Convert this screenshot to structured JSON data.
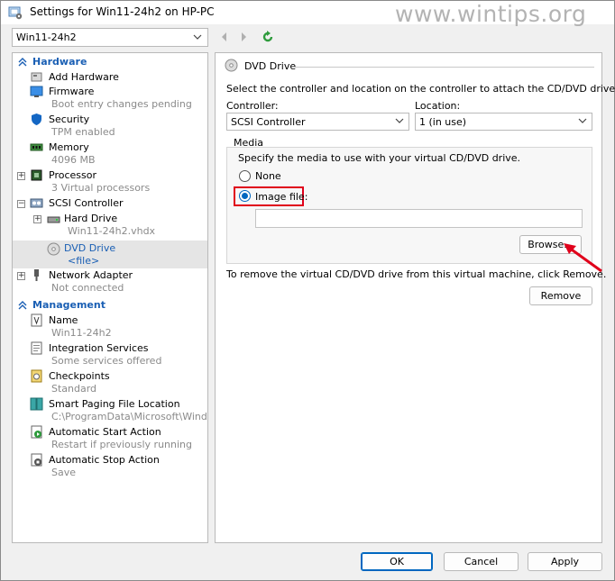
{
  "window": {
    "title": "Settings for Win11-24h2 on HP-PC",
    "watermark": "www.wintips.org"
  },
  "vm_selector": {
    "value": "Win11-24h2"
  },
  "tree": {
    "hardware_header": "Hardware",
    "management_header": "Management",
    "hardware_items": [
      {
        "label": "Add Hardware",
        "sub": ""
      },
      {
        "label": "Firmware",
        "sub": "Boot entry changes pending"
      },
      {
        "label": "Security",
        "sub": "TPM enabled"
      },
      {
        "label": "Memory",
        "sub": "4096 MB"
      },
      {
        "label": "Processor",
        "sub": "3 Virtual processors"
      },
      {
        "label": "SCSI Controller",
        "sub": ""
      },
      {
        "label": "Hard Drive",
        "sub": "Win11-24h2.vhdx"
      },
      {
        "label": "DVD Drive",
        "sub": "<file>"
      },
      {
        "label": "Network Adapter",
        "sub": "Not connected"
      }
    ],
    "management_items": [
      {
        "label": "Name",
        "sub": "Win11-24h2"
      },
      {
        "label": "Integration Services",
        "sub": "Some services offered"
      },
      {
        "label": "Checkpoints",
        "sub": "Standard"
      },
      {
        "label": "Smart Paging File Location",
        "sub": "C:\\ProgramData\\Microsoft\\Windo..."
      },
      {
        "label": "Automatic Start Action",
        "sub": "Restart if previously running"
      },
      {
        "label": "Automatic Stop Action",
        "sub": "Save"
      }
    ]
  },
  "dvd_panel": {
    "title": "DVD Drive",
    "description": "Select the controller and location on the controller to attach the CD/DVD drive.",
    "controller_label": "Controller:",
    "controller_value": "SCSI Controller",
    "location_label": "Location:",
    "location_value": "1 (in use)",
    "media_label": "Media",
    "media_description": "Specify the media to use with your virtual CD/DVD drive.",
    "none_label": "None",
    "image_file_label": "Image file:",
    "image_file_value": "",
    "selected_option": "image_file",
    "browse_label": "Browse...",
    "remove_description": "To remove the virtual CD/DVD drive from this virtual machine, click Remove.",
    "remove_label": "Remove"
  },
  "footer": {
    "ok": "OK",
    "cancel": "Cancel",
    "apply": "Apply"
  },
  "colors": {
    "accent": "#0067c0",
    "header_text": "#1a5fb4",
    "highlight": "#e0001b"
  }
}
